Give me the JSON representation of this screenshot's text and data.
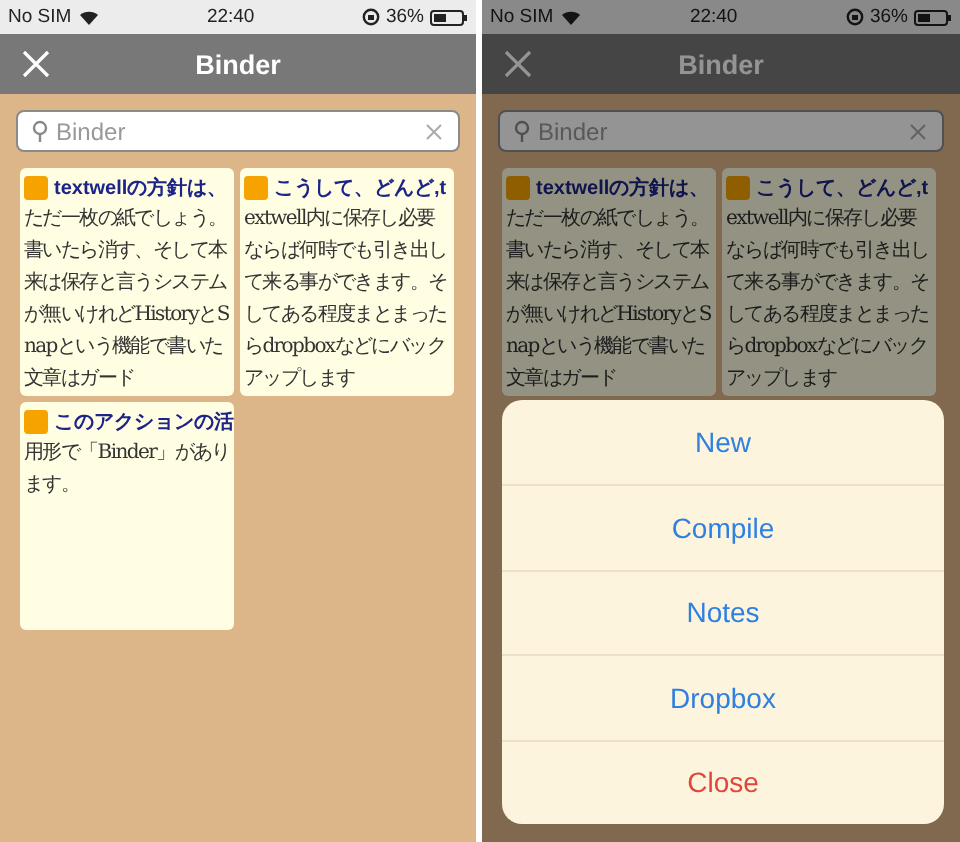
{
  "screens": [
    {
      "status_bar": {
        "carrier": "No SIM",
        "time": "22:40",
        "battery": "36%"
      },
      "nav_bar": {
        "title": "Binder"
      },
      "search": {
        "placeholder": "Binder"
      },
      "dimmed": false,
      "cards": [
        {
          "title": "textwellの方針は、",
          "body": "ただ一枚の紙でしょう。書いたら消す、そして本来は保存と言うシステムが無いけれどHistoryとSnapという機能で書いた文章はガード"
        },
        {
          "title": "こうして、どんど,t",
          "body": "extwell内に保存し必要ならば何時でも引き出して来る事ができます。そしてある程度まとまったらdropboxなどにバックアップします"
        },
        {
          "title": "このアクションの活",
          "body": "用形で「Binder」があります。"
        }
      ]
    },
    {
      "status_bar": {
        "carrier": "No SIM",
        "time": "22:40",
        "battery": "36%"
      },
      "nav_bar": {
        "title": "Binder"
      },
      "search": {
        "placeholder": "Binder"
      },
      "dimmed": true,
      "cards": [
        {
          "title": "textwellの方針は、",
          "body": "ただ一枚の紙でしょう。書いたら消す、そして本来は保存と言うシステムが無いけれどHistoryとSnapという機能で書いた文章はガード"
        },
        {
          "title": "こうして、どんど,t",
          "body": "extwell内に保存し必要ならば何時でも引き出して来る事ができます。そしてある程度まとまったらdropboxなどにバックアップします"
        }
      ],
      "action_sheet": [
        {
          "label": "New",
          "kind": "default"
        },
        {
          "label": "Compile",
          "kind": "default"
        },
        {
          "label": "Notes",
          "kind": "default"
        },
        {
          "label": "Dropbox",
          "kind": "default"
        },
        {
          "label": "Close",
          "kind": "destructive"
        }
      ]
    }
  ]
}
